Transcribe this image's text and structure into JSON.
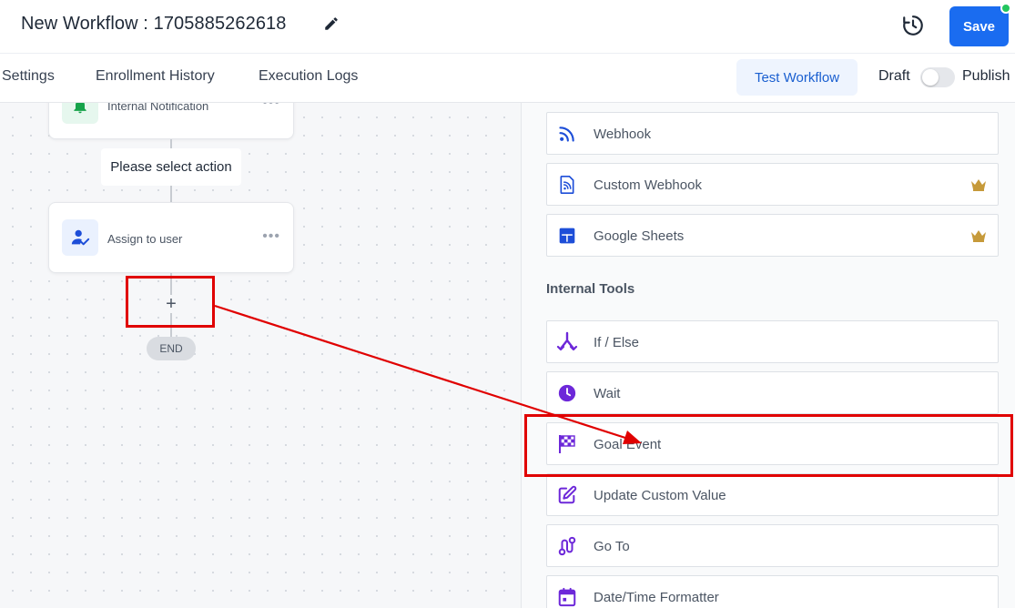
{
  "header": {
    "title": "New Workflow : 1705885262618",
    "save_label": "Save"
  },
  "tabs": [
    {
      "label": "Settings"
    },
    {
      "label": "Enrollment History"
    },
    {
      "label": "Execution Logs"
    }
  ],
  "toolbar": {
    "test_label": "Test Workflow",
    "draft_label": "Draft",
    "publish_label": "Publish",
    "publish_toggle_on": false
  },
  "canvas": {
    "nodes": [
      {
        "label": "Internal Notification",
        "icon": "bell-icon"
      },
      {
        "label": "Assign to user",
        "icon": "user-check-icon"
      }
    ],
    "select_action_label": "Please select action",
    "plus_label": "+",
    "end_label": "END"
  },
  "panel": {
    "external_items": [
      {
        "label": "Webhook",
        "icon": "rss-icon",
        "premium": false
      },
      {
        "label": "Custom Webhook",
        "icon": "file-rss-icon",
        "premium": true
      },
      {
        "label": "Google Sheets",
        "icon": "sheets-icon",
        "premium": true
      }
    ],
    "internal_title": "Internal Tools",
    "internal_items": [
      {
        "label": "If / Else",
        "icon": "split-icon"
      },
      {
        "label": "Wait",
        "icon": "clock-icon"
      },
      {
        "label": "Goal Event",
        "icon": "checkered-flag-icon"
      },
      {
        "label": "Update Custom Value",
        "icon": "edit-square-icon"
      },
      {
        "label": "Go To",
        "icon": "route-icon"
      },
      {
        "label": "Date/Time Formatter",
        "icon": "calendar-icon"
      }
    ]
  },
  "colors": {
    "primary": "#1a6cf0",
    "external_icon": "#1d4ed8",
    "internal_icon": "#6d28d9",
    "crown": "#c69a3a",
    "annotation": "#e00000",
    "status_dot": "#22c55e"
  }
}
